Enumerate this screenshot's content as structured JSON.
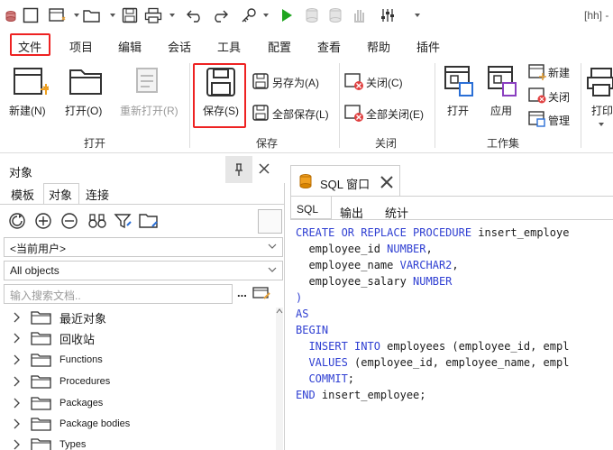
{
  "window": {
    "title_suffix": "[hh] -"
  },
  "menu": [
    "文件",
    "项目",
    "编辑",
    "会话",
    "工具",
    "配置",
    "查看",
    "帮助",
    "插件"
  ],
  "ribbon": {
    "open_group": {
      "label": "打开",
      "new": "新建(N)",
      "open": "打开(O)",
      "reopen": "重新打开(R)"
    },
    "save_group": {
      "label": "保存",
      "save": "保存(S)",
      "save_as": "另存为(A)",
      "save_all": "全部保存(L)"
    },
    "close_group": {
      "label": "关闭",
      "close": "关闭(C)",
      "close_all": "全部关闭(E)"
    },
    "workset_group": {
      "label": "工作集",
      "open": "打开",
      "apply": "应用",
      "new": "新建",
      "close": "关闭",
      "manage": "管理"
    },
    "print_label": "打印"
  },
  "objects_panel": {
    "title": "对象",
    "tabs": [
      "模板",
      "对象",
      "连接"
    ],
    "active_tab": "对象",
    "user_select": "<当前用户>",
    "objects_select": "All objects",
    "search_placeholder": "输入搜索文档..",
    "more": "...",
    "tree": [
      "最近对象",
      "回收站",
      "Functions",
      "Procedures",
      "Packages",
      "Package bodies",
      "Types"
    ]
  },
  "editor": {
    "tab_title": "SQL 窗口",
    "subtabs": [
      "SQL",
      "输出",
      "统计"
    ],
    "active_subtab": "SQL",
    "lines": [
      [
        {
          "t": "CREATE OR REPLACE PROCEDURE",
          "c": "kw"
        },
        {
          "t": " insert_employe",
          "c": ""
        }
      ],
      [
        {
          "t": "  employee_id ",
          "c": ""
        },
        {
          "t": "NUMBER",
          "c": "kw"
        },
        {
          "t": ",",
          "c": ""
        }
      ],
      [
        {
          "t": "  employee_name ",
          "c": ""
        },
        {
          "t": "VARCHAR2",
          "c": "kw"
        },
        {
          "t": ",",
          "c": ""
        }
      ],
      [
        {
          "t": "  employee_salary ",
          "c": ""
        },
        {
          "t": "NUMBER",
          "c": "kw"
        }
      ],
      [
        {
          "t": ")",
          "c": "kw"
        }
      ],
      [
        {
          "t": "AS",
          "c": "kw"
        }
      ],
      [
        {
          "t": "BEGIN",
          "c": "kw"
        }
      ],
      [
        {
          "t": "  INSERT INTO",
          "c": "kw"
        },
        {
          "t": " employees (employee_id, empl",
          "c": ""
        }
      ],
      [
        {
          "t": "  VALUES",
          "c": "kw"
        },
        {
          "t": " (employee_id, employee_name, empl",
          "c": ""
        }
      ],
      [
        {
          "t": "  COMMIT",
          "c": "kw"
        },
        {
          "t": ";",
          "c": ""
        }
      ],
      [
        {
          "t": "END",
          "c": "kw"
        },
        {
          "t": " insert_employee;",
          "c": ""
        }
      ]
    ]
  },
  "colors": {
    "accent_red": "#e02020",
    "keyword_blue": "#2f3fd2",
    "run_green": "#1fa51f"
  }
}
